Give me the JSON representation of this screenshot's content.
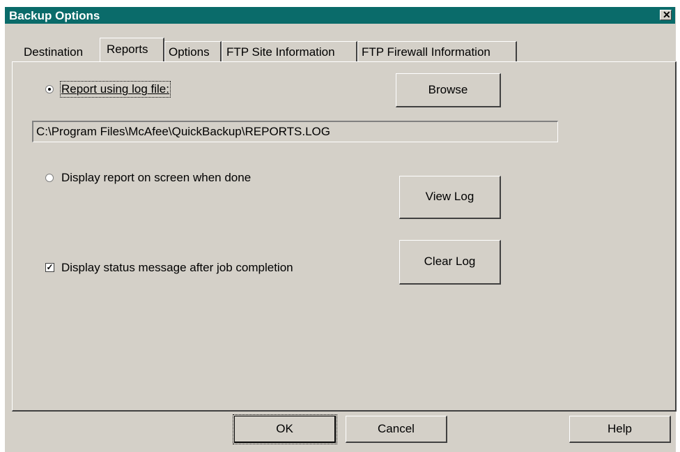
{
  "window": {
    "title": "Backup Options",
    "close_glyph": "✕"
  },
  "tabs": [
    {
      "label": "Destination"
    },
    {
      "label": "Reports"
    },
    {
      "label": "Options"
    },
    {
      "label": "FTP Site Information"
    },
    {
      "label": "FTP Firewall Information"
    }
  ],
  "active_tab": "Reports",
  "reports": {
    "log_option_label": "Report using log file:",
    "log_option_selected": true,
    "log_path": "C:\\Program Files\\McAfee\\QuickBackup\\REPORTS.LOG",
    "screen_option_label": "Display report on screen when done",
    "screen_option_selected": false,
    "status_checkbox_label": "Display status message after job completion",
    "status_checkbox_checked": true,
    "browse_label": "Browse",
    "view_log_label": "View Log",
    "clear_log_label": "Clear Log"
  },
  "footer": {
    "ok_label": "OK",
    "cancel_label": "Cancel",
    "help_label": "Help"
  },
  "colors": {
    "title_bar": "#0a6b6a",
    "face": "#d4d0c8"
  }
}
